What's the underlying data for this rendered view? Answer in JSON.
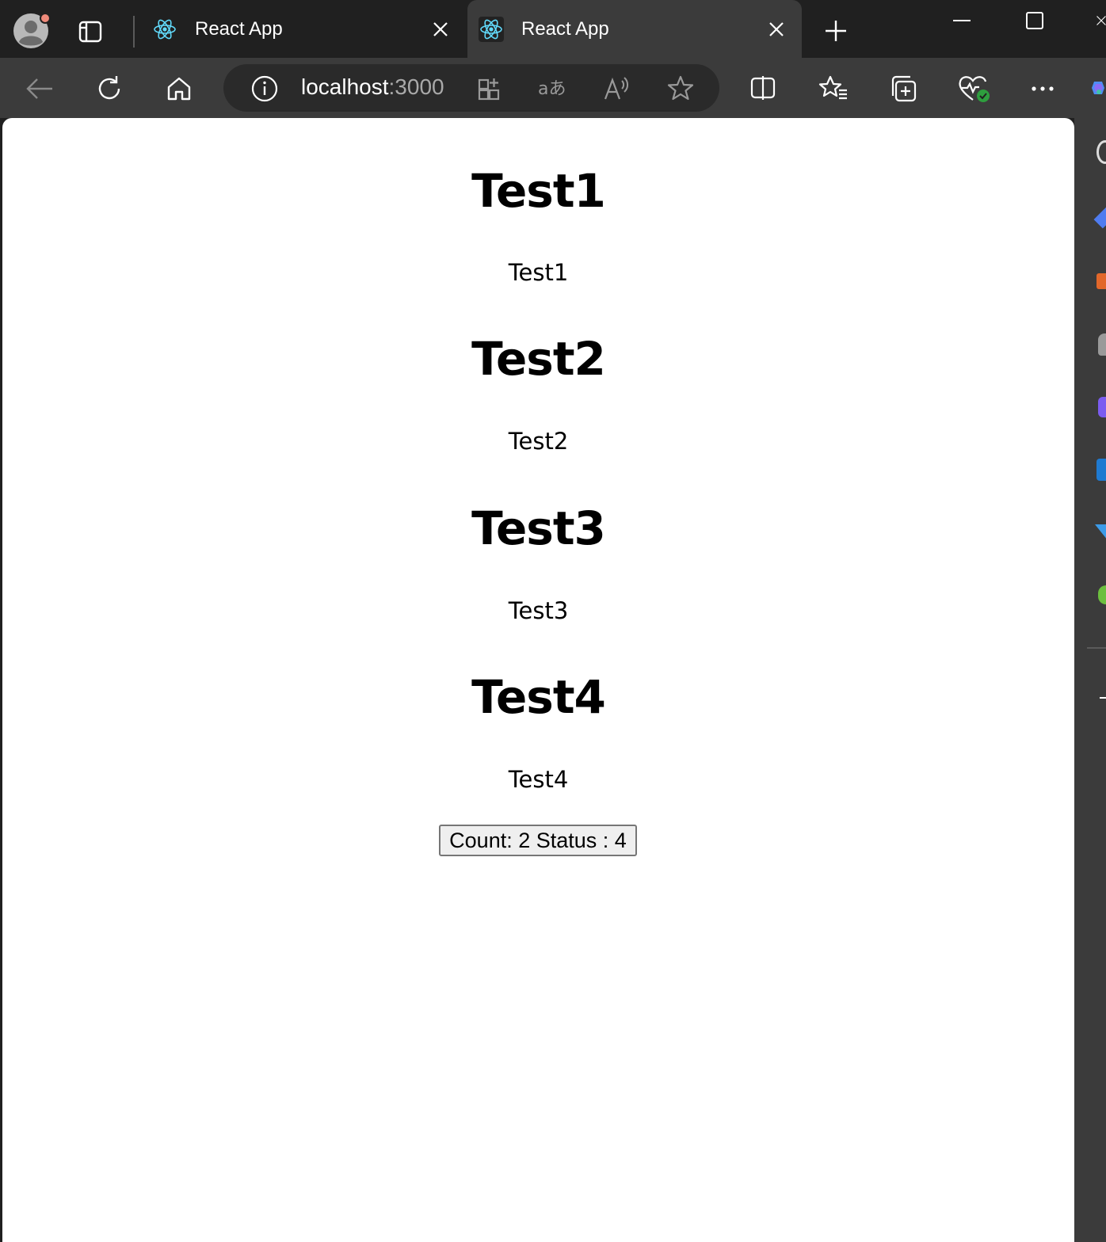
{
  "browser": {
    "tabs": [
      {
        "title": "React App",
        "active": false
      },
      {
        "title": "React App",
        "active": true
      }
    ],
    "address": {
      "host": "localhost",
      "port": ":3000"
    },
    "icons": {
      "profile": "profile-avatar-icon",
      "tab_actions": "tab-actions-icon",
      "new_tab": "plus-icon",
      "minimize": "minimize-icon",
      "maximize": "maximize-icon",
      "close_window": "close-icon",
      "back": "back-arrow-icon",
      "refresh": "refresh-icon",
      "home": "home-icon",
      "site_info": "info-icon",
      "app_available": "apps-icon",
      "translate": "translate-icon",
      "read_aloud": "read-aloud-icon",
      "favorite": "star-icon",
      "split_screen": "split-screen-icon",
      "favorites": "favorites-list-icon",
      "collections": "collections-icon",
      "browser_essentials": "heart-pulse-icon",
      "more": "more-icon",
      "copilot": "copilot-icon"
    }
  },
  "page": {
    "sections": [
      {
        "heading": "Test1",
        "text": "Test1"
      },
      {
        "heading": "Test2",
        "text": "Test2"
      },
      {
        "heading": "Test3",
        "text": "Test3"
      },
      {
        "heading": "Test4",
        "text": "Test4"
      }
    ],
    "button_label": "Count: 2 Status : 4"
  },
  "colors": {
    "titlebar": "#202020",
    "toolbar": "#3b3b3b",
    "page_bg": "#ffffff",
    "react_blue": "#61dafb"
  }
}
